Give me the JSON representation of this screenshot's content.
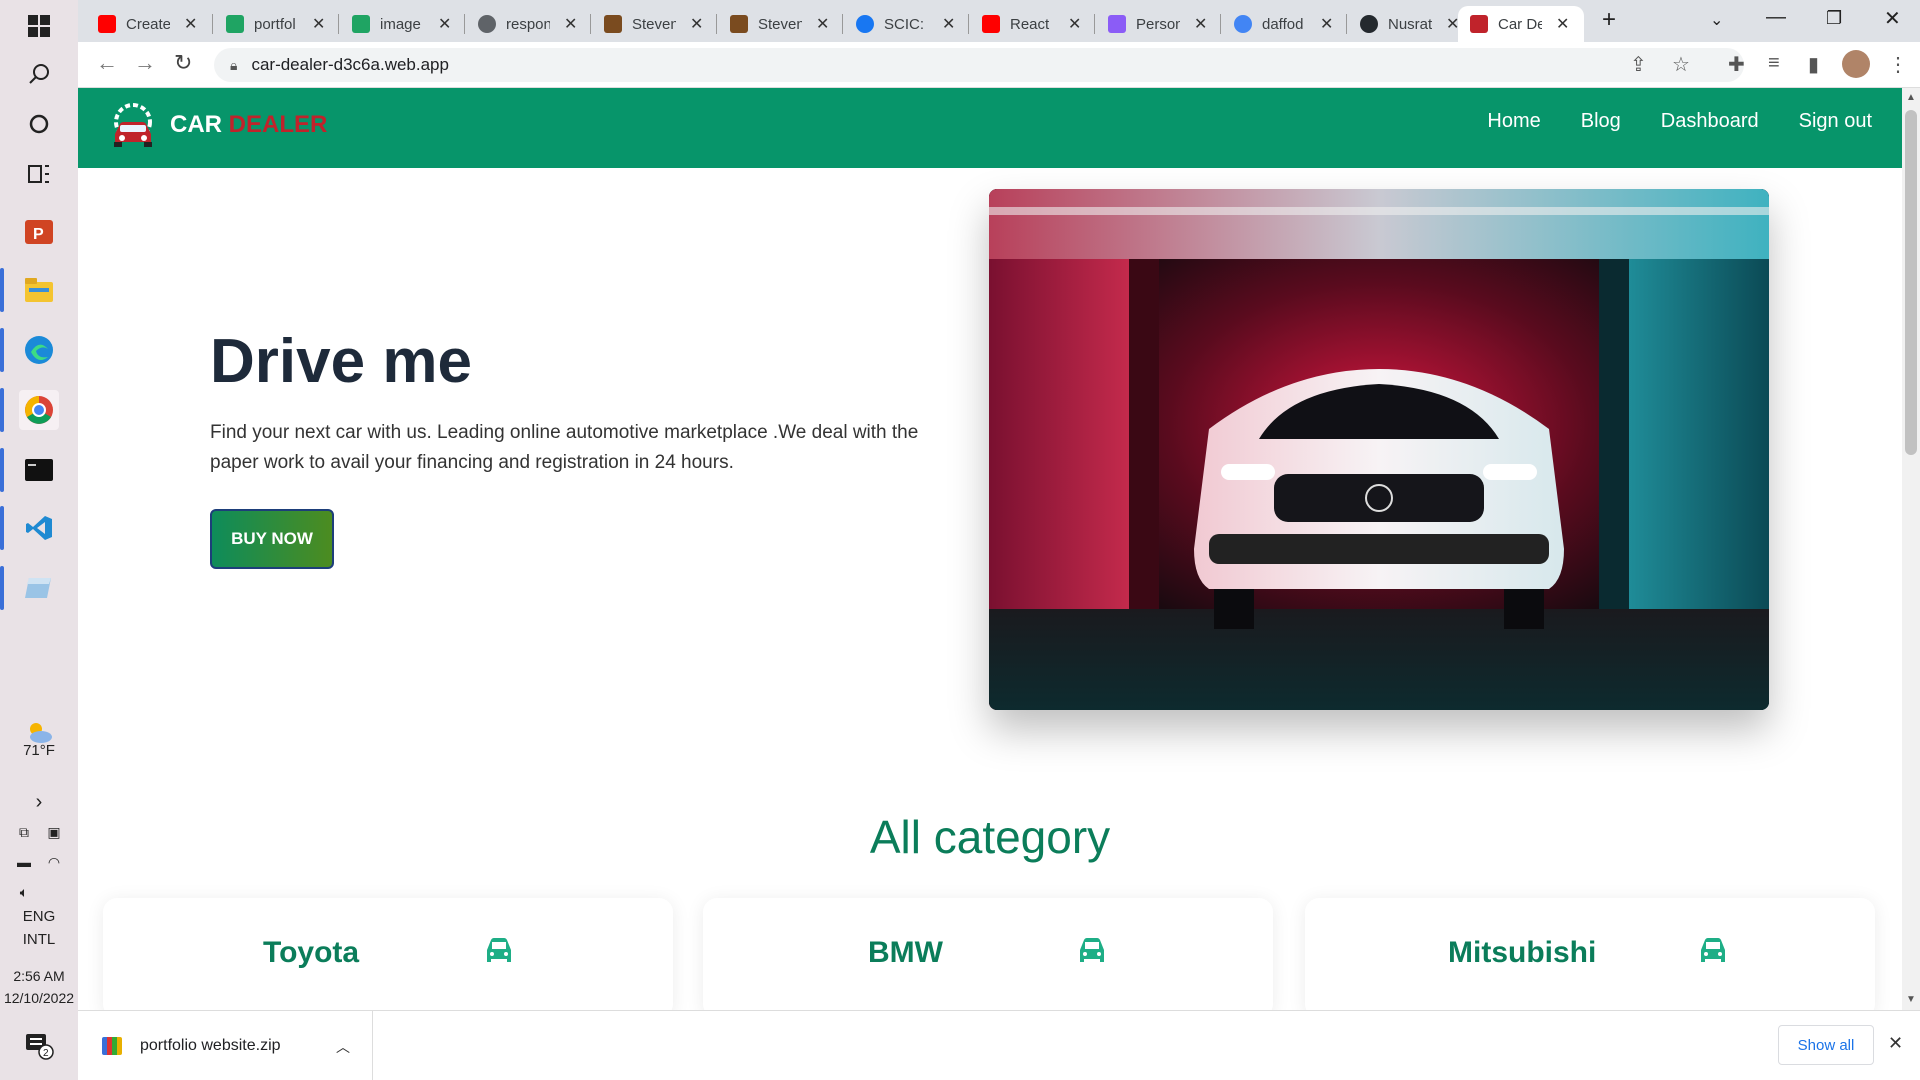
{
  "taskbar": {
    "weather_temp": "71°F",
    "language": "ENG",
    "language_variant": "INTL",
    "time": "2:56 AM",
    "date": "12/10/2022",
    "notification_count": "2"
  },
  "browser": {
    "tabs": [
      {
        "label": "Create",
        "favicon_color": "#ff0000"
      },
      {
        "label": "portfol",
        "favicon_color": "#1fa463"
      },
      {
        "label": "image",
        "favicon_color": "#1fa463"
      },
      {
        "label": "respon",
        "favicon_color": "#5f6368"
      },
      {
        "label": "Steven",
        "favicon_color": "#7a4b1f"
      },
      {
        "label": "Steven",
        "favicon_color": "#7a4b1f"
      },
      {
        "label": "SCIC: J",
        "favicon_color": "#1877f2"
      },
      {
        "label": "React",
        "favicon_color": "#ff0000"
      },
      {
        "label": "Person",
        "favicon_color": "#8b5cf6"
      },
      {
        "label": "daffod",
        "favicon_color": "#4285f4"
      },
      {
        "label": "Nusrat",
        "favicon_color": "#24292e"
      },
      {
        "label": "Car De",
        "favicon_color": "#c0232b",
        "active": true
      }
    ],
    "url": "car-dealer-d3c6a.web.app"
  },
  "site": {
    "logo": {
      "word1": "CAR",
      "word2": "DEALER"
    },
    "nav": [
      "Home",
      "Blog",
      "Dashboard",
      "Sign out"
    ],
    "hero": {
      "title": "Drive me",
      "text": "Find your next car with us. Leading online automotive marketplace .We deal with the paper work to avail your financing and registration in 24 hours.",
      "button": "BUY NOW"
    },
    "categories_title": "All category",
    "categories": [
      {
        "name": "Toyota",
        "icon": "car-icon"
      },
      {
        "name": "BMW",
        "icon": "car-icon"
      },
      {
        "name": "Mitsubishi",
        "icon": "car-icon"
      }
    ]
  },
  "downloads": {
    "file_name": "portfolio website.zip",
    "show_all": "Show all"
  },
  "colors": {
    "brand_green": "#07956a",
    "category_green": "#0b7d5a",
    "logo_red": "#c0232b"
  }
}
